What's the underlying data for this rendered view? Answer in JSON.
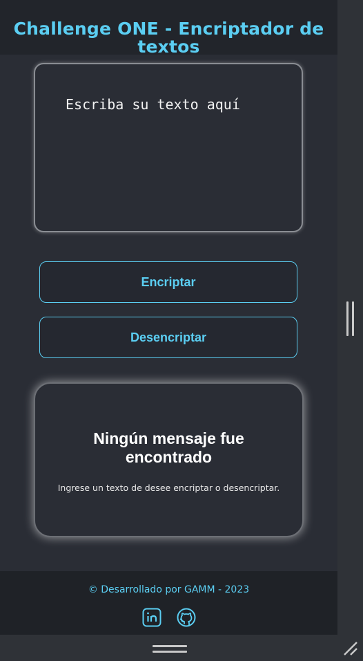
{
  "header": {
    "title": "Challenge ONE - Encriptador de textos"
  },
  "input": {
    "placeholder": "Escriba su texto aquí"
  },
  "buttons": {
    "encrypt": "Encriptar",
    "decrypt": "Desencriptar"
  },
  "result": {
    "title": "Ningún mensaje fue encontrado",
    "text": "Ingrese un texto de desee encriptar o desencriptar."
  },
  "footer": {
    "credit": "© Desarrollado por GAMM - 2023",
    "icons": [
      "linkedin-icon",
      "github-icon"
    ]
  },
  "colors": {
    "accent": "#5bcef2",
    "background": "#2a2d35",
    "header": "#22252b",
    "footer": "#1f2227"
  }
}
